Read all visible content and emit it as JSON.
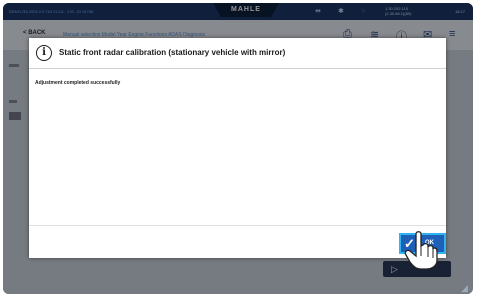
{
  "topbar": {
    "vehicle": "DEMO-RA 2009 2.0 TDI CCLA - 176 - ID 91708",
    "brand": "MAHLE",
    "version": "1.30.292.110\n(1.30.86.1)(80)",
    "time": "16:17"
  },
  "nav": {
    "back_label": "BACK",
    "breadcrumb": "Manual selection   Model   Year   Engine   Functions   ADAS   Diagnosis"
  },
  "dialog": {
    "title": "Static front radar calibration (stationary vehicle with mirror)",
    "message": "Adjustment completed successfully",
    "ok_label": "OK"
  },
  "colors": {
    "ok_button": "#1e5fb8",
    "ok_border": "#2fb4f2",
    "topbar": "#1c3868"
  }
}
